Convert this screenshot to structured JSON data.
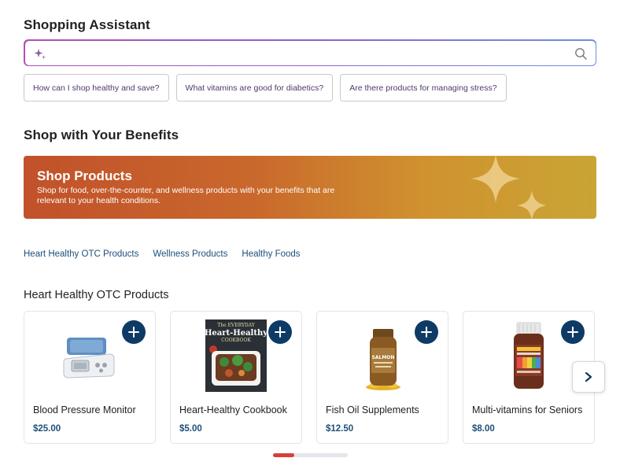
{
  "assistant": {
    "title": "Shopping Assistant",
    "search_placeholder": "",
    "search_value": "",
    "sparkle_icon": "sparkle-icon",
    "search_icon": "search-icon",
    "suggestions": [
      "How can I shop healthy and save?",
      "What vitamins are good for diabetics?",
      "Are there products for managing stress?"
    ]
  },
  "benefits": {
    "title": "Shop with Your Benefits",
    "banner": {
      "title": "Shop Products",
      "subtitle": "Shop for food, over-the-counter, and wellness products with your benefits that are relevant to your health conditions.",
      "gradient_start": "#c1512a",
      "gradient_end": "#c9a535"
    }
  },
  "categories": [
    "Heart Healthy OTC Products",
    "Wellness Products",
    "Healthy Foods"
  ],
  "section": {
    "title": "Heart Healthy OTC Products",
    "products": [
      {
        "name": "Blood Pressure Monitor",
        "price": "$25.00",
        "image": "blood-pressure-monitor"
      },
      {
        "name": "Heart-Healthy Cookbook",
        "price": "$5.00",
        "image": "cookbook",
        "cover_top": "The EVERYDAY",
        "cover_title": "Heart-Healthy",
        "cover_sub": "COOKBOOK"
      },
      {
        "name": "Fish Oil Supplements",
        "price": "$12.50",
        "image": "fish-oil-bottle",
        "label": "SALMON"
      },
      {
        "name": "Multi-vitamins for Seniors",
        "price": "$8.00",
        "image": "multivitamin-bottle"
      }
    ],
    "add_icon": "plus-icon",
    "next_icon": "chevron-right-icon"
  },
  "pagination": {
    "progress": 0.28,
    "active_color": "#d7403a"
  },
  "colors": {
    "accent": "#0d3b66",
    "link": "#1d4f7a",
    "chip_text": "#4f3a6b"
  }
}
